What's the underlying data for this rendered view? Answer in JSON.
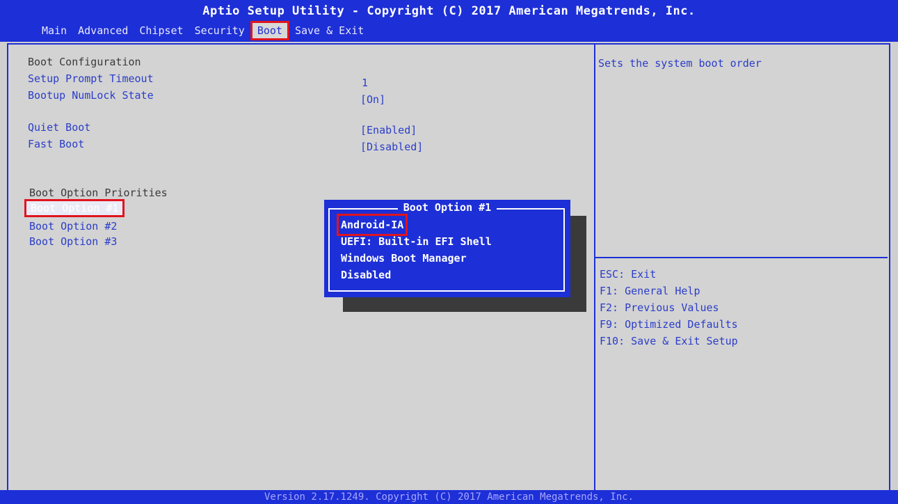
{
  "header": {
    "title": "Aptio Setup Utility - Copyright (C) 2017 American Megatrends, Inc.",
    "menu": [
      "Main",
      "Advanced",
      "Chipset",
      "Security",
      "Boot",
      "Save & Exit"
    ],
    "active_menu": "Boot"
  },
  "settings": {
    "boot_configuration": "Boot Configuration",
    "setup_prompt_timeout": {
      "label": "Setup Prompt Timeout",
      "value": "1"
    },
    "bootup_numlock_state": {
      "label": "Bootup NumLock State",
      "value": "[On]"
    },
    "quiet_boot": {
      "label": "Quiet Boot",
      "value": "[Enabled]"
    },
    "fast_boot": {
      "label": "Fast Boot",
      "value": "[Disabled]"
    },
    "boot_option_priorities": "Boot Option Priorities",
    "boot_options": [
      "Boot Option #1",
      "Boot Option #2",
      "Boot Option #3"
    ]
  },
  "popup": {
    "title": "Boot Option #1",
    "options": [
      "Android-IA",
      "UEFI: Built-in EFI Shell",
      "Windows Boot Manager",
      "Disabled"
    ],
    "selected": "Android-IA"
  },
  "help": {
    "description": "Sets the system boot order",
    "keys": [
      "ESC: Exit",
      "F1: General Help",
      "F2: Previous Values",
      "F9: Optimized Defaults",
      "F10: Save & Exit Setup"
    ]
  },
  "footer": {
    "version": "Version 2.17.1249. Copyright (C) 2017 American Megatrends, Inc."
  },
  "colors": {
    "bios_blue": "#1d2fd6",
    "panel_gray": "#d3d3d3",
    "text_blue": "#2b3dc8",
    "highlight_red": "#e0141e"
  }
}
